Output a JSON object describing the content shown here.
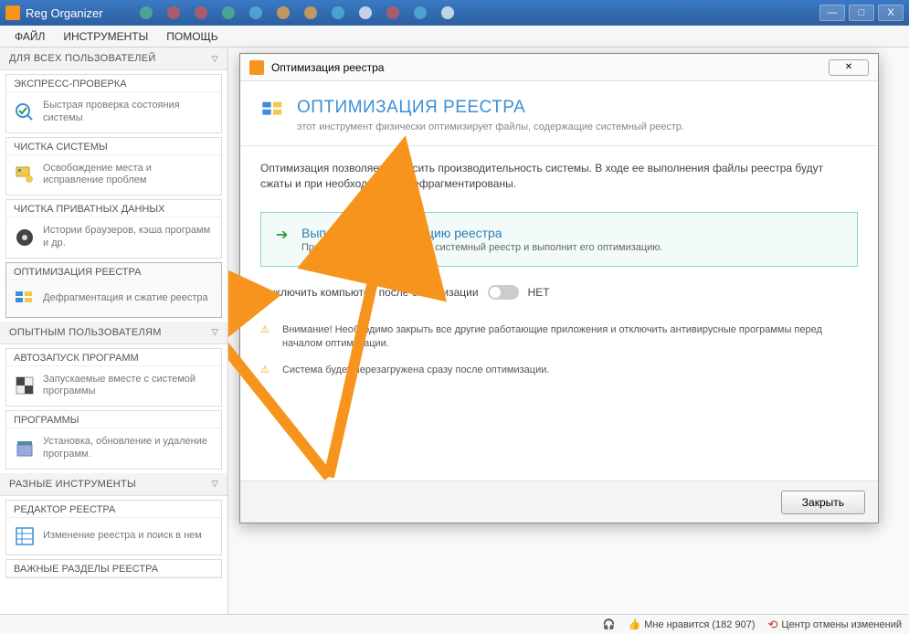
{
  "app": {
    "title": "Reg Organizer"
  },
  "menu": {
    "file": "ФАЙЛ",
    "tools": "ИНСТРУМЕНТЫ",
    "help": "ПОМОЩЬ"
  },
  "sidebar": {
    "sec_all_users": "ДЛЯ ВСЕХ ПОЛЬЗОВАТЕЛЕЙ",
    "express": {
      "title": "ЭКСПРЕСС-ПРОВЕРКА",
      "desc": "Быстрая проверка состояния системы"
    },
    "cleanup": {
      "title": "ЧИСТКА СИСТЕМЫ",
      "desc": "Освобождение места и исправление проблем"
    },
    "private": {
      "title": "ЧИСТКА ПРИВАТНЫХ ДАННЫХ",
      "desc": "Истории браузеров, кэша программ и др."
    },
    "registry": {
      "title": "ОПТИМИЗАЦИЯ РЕЕСТРА",
      "desc": "Дефрагментация и сжатие реестра"
    },
    "sec_experienced": "ОПЫТНЫМ ПОЛЬЗОВАТЕЛЯМ",
    "autorun": {
      "title": "АВТОЗАПУСК ПРОГРАММ",
      "desc": "Запускаемые вместе с системой программы"
    },
    "programs": {
      "title": "ПРОГРАММЫ",
      "desc": "Установка, обновление и удаление программ."
    },
    "sec_misc": "РАЗНЫЕ ИНСТРУМЕНТЫ",
    "regeditor": {
      "title": "РЕДАКТОР РЕЕСТРА",
      "desc": "Изменение реестра и поиск в нем"
    },
    "important": {
      "title": "ВАЖНЫЕ РАЗДЕЛЫ РЕЕСТРА"
    }
  },
  "dialog": {
    "title": "Оптимизация реестра",
    "heading": "ОПТИМИЗАЦИЯ РЕЕСТРА",
    "sub": "этот инструмент физически оптимизирует файлы, содержащие системный реестр.",
    "intro": "Оптимизация позволяет повысить производительность системы. В ходе ее выполнения файлы реестра будут сжаты и при необходимости дефрагментированы.",
    "action_title": "Выполнить оптимизацию реестра",
    "action_desc": "Программа проанализирует системный реестр и выполнит его оптимизацию.",
    "shutdown_label": "Выключить компьютер после оптимизации",
    "shutdown_state": "НЕТ",
    "warn1": "Внимание! Необходимо закрыть все другие работающие приложения и отключить антивирусные программы перед началом оптимизации.",
    "warn2": "Система будет перезагружена сразу после оптимизации.",
    "close_btn": "Закрыть"
  },
  "status": {
    "like": "Мне нравится (182 907)",
    "undo": "Центр отмены изменений"
  }
}
